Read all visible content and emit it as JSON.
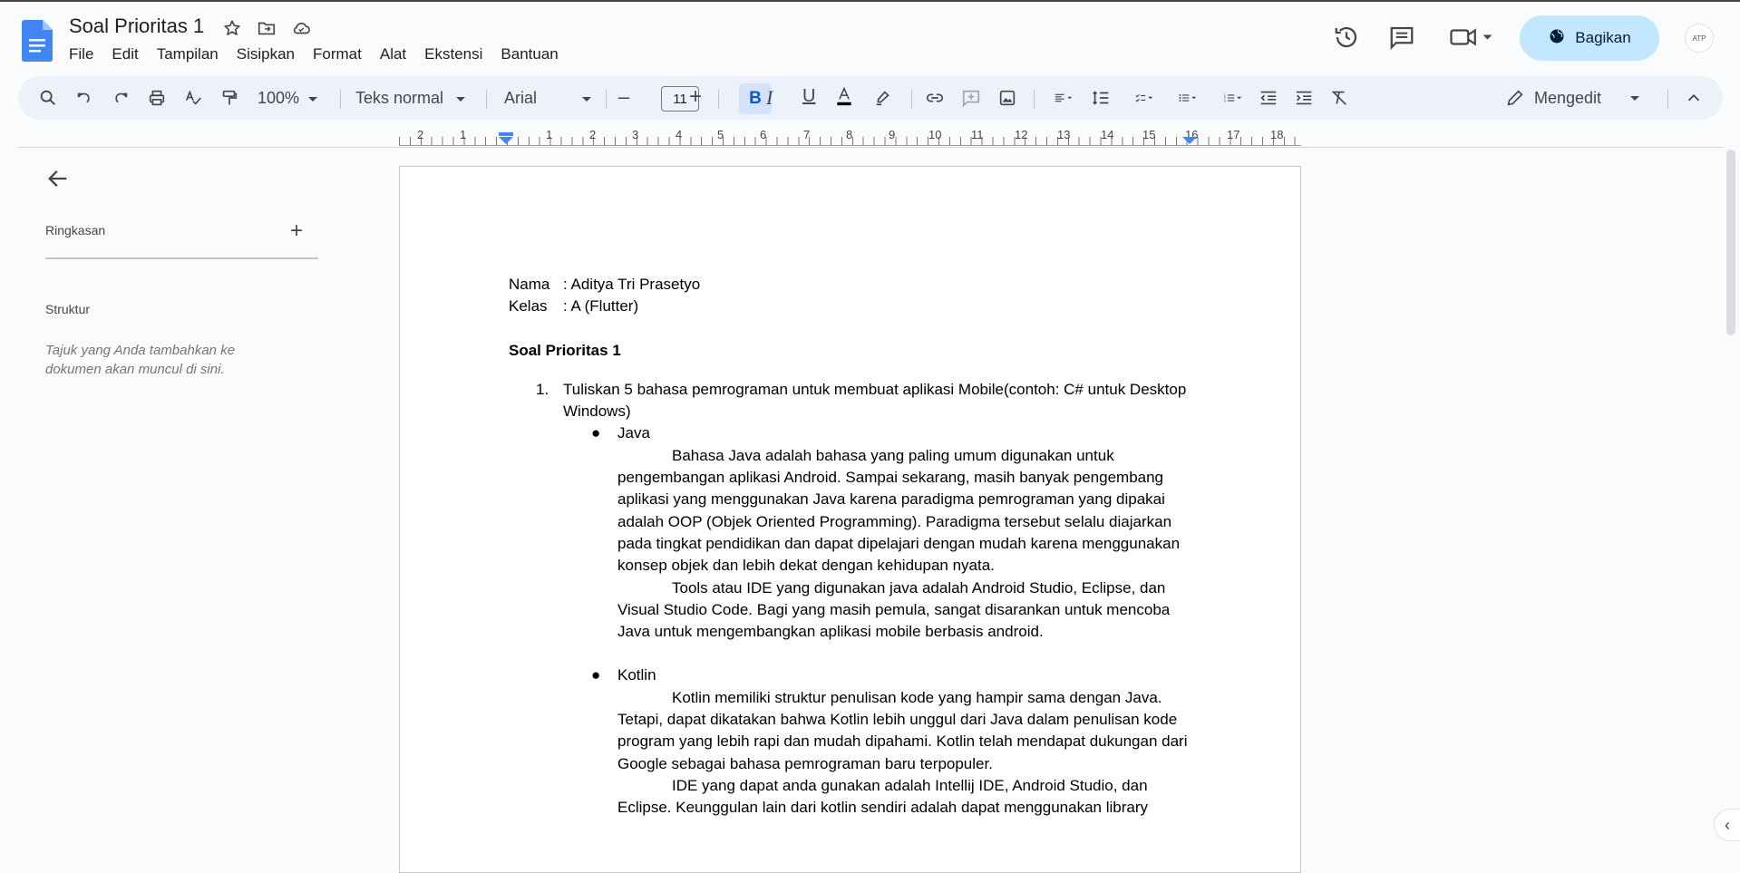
{
  "app": {
    "doc_title": "Soal Prioritas 1",
    "menu": [
      "File",
      "Edit",
      "Tampilan",
      "Sisipkan",
      "Format",
      "Alat",
      "Ekstensi",
      "Bantuan"
    ],
    "share_label": "Bagikan",
    "avatar_text": "ATP"
  },
  "toolbar": {
    "zoom": "100%",
    "style": "Teks normal",
    "font": "Arial",
    "font_size": "11",
    "bold": "B",
    "mode": "Mengedit",
    "ruler_labels": [
      "2",
      "1",
      "1",
      "2",
      "3",
      "4",
      "5",
      "6",
      "7",
      "8",
      "9",
      "10",
      "11",
      "12",
      "13",
      "14",
      "15",
      "16",
      "17",
      "18"
    ]
  },
  "sidebar": {
    "summary_label": "Ringkasan",
    "structure_label": "Struktur",
    "structure_note": "Tajuk yang Anda tambahkan ke dokumen akan muncul di sini."
  },
  "document": {
    "name_label": "Nama",
    "name_value": ": Aditya Tri Prasetyo",
    "class_label": "Kelas",
    "class_value": ": A (Flutter)",
    "heading": "Soal Prioritas 1",
    "q1_num": "1.",
    "q1_text": "Tuliskan 5 bahasa pemrograman untuk membuat aplikasi Mobile(contoh: C# untuk Desktop Windows)",
    "bullet_symbol": "●",
    "java_title": "Java",
    "java_p1": "Bahasa Java adalah bahasa yang paling umum digunakan untuk pengembangan aplikasi Android. Sampai sekarang, masih banyak pengembang aplikasi yang menggunakan Java karena paradigma pemrograman yang dipakai adalah OOP (Objek Oriented Programming). Paradigma tersebut selalu diajarkan pada tingkat pendidikan dan dapat dipelajari dengan mudah karena menggunakan konsep objek dan lebih dekat dengan kehidupan nyata.",
    "java_p2": "Tools atau IDE yang digunakan java adalah Android Studio, Eclipse, dan Visual Studio Code. Bagi yang masih pemula, sangat disarankan untuk mencoba Java untuk mengembangkan aplikasi mobile berbasis android.",
    "kotlin_title": "Kotlin",
    "kotlin_p1": "Kotlin memiliki struktur penulisan kode yang hampir sama dengan Java. Tetapi, dapat dikatakan bahwa Kotlin lebih unggul dari Java dalam penulisan kode program yang lebih rapi dan mudah dipahami. Kotlin telah mendapat dukungan dari Google sebagai bahasa pemrograman baru terpopuler.",
    "kotlin_p2": "IDE yang dapat anda gunakan adalah Intellij IDE, Android Studio, dan Eclipse. Keunggulan lain dari kotlin sendiri adalah dapat menggunakan library"
  },
  "colors": {
    "accent": "#0b57d0",
    "share_bg": "#c2e7ff",
    "toolbar_bg": "#edf2fa",
    "doc_blue": "#4285f4"
  }
}
